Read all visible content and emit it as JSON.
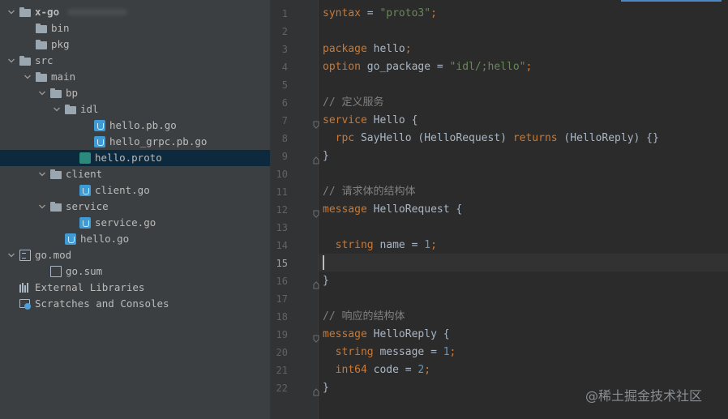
{
  "project_tree": {
    "rows": [
      {
        "label": "x-go",
        "icon": "folder-icon",
        "chevron": "down"
      },
      {
        "label": "bin",
        "icon": "folder-icon",
        "chevron": "none"
      },
      {
        "label": "pkg",
        "icon": "folder-icon",
        "chevron": "none"
      },
      {
        "label": "src",
        "icon": "folder-icon",
        "chevron": "down"
      },
      {
        "label": "main",
        "icon": "folder-icon",
        "chevron": "down"
      },
      {
        "label": "bp",
        "icon": "folder-icon",
        "chevron": "down"
      },
      {
        "label": "idl",
        "icon": "folder-icon",
        "chevron": "down"
      },
      {
        "label": "hello.pb.go",
        "icon": "go-file-icon",
        "chevron": "none"
      },
      {
        "label": "hello_grpc.pb.go",
        "icon": "go-file-icon",
        "chevron": "none"
      },
      {
        "label": "hello.proto",
        "icon": "proto-file-icon",
        "chevron": "none",
        "selected": true
      },
      {
        "label": "client",
        "icon": "folder-icon",
        "chevron": "down"
      },
      {
        "label": "client.go",
        "icon": "go-file-icon",
        "chevron": "none"
      },
      {
        "label": "service",
        "icon": "folder-icon",
        "chevron": "down"
      },
      {
        "label": "service.go",
        "icon": "go-file-icon",
        "chevron": "none"
      },
      {
        "label": "hello.go",
        "icon": "go-file-icon",
        "chevron": "none"
      },
      {
        "label": "go.mod",
        "icon": "go-mod-icon",
        "chevron": "down"
      },
      {
        "label": "go.sum",
        "icon": "go-sum-icon",
        "chevron": "none"
      },
      {
        "label": "External Libraries",
        "icon": "library-icon",
        "chevron": "none"
      },
      {
        "label": "Scratches and Consoles",
        "icon": "scratch-icon",
        "chevron": "none"
      }
    ]
  },
  "editor": {
    "current_line": "15",
    "line_numbers": [
      "1",
      "2",
      "3",
      "4",
      "5",
      "6",
      "7",
      "8",
      "9",
      "10",
      "11",
      "12",
      "13",
      "14",
      "15",
      "16",
      "17",
      "18",
      "19",
      "20",
      "21",
      "22"
    ],
    "lines": [
      [
        {
          "t": "syntax",
          "c": "kw"
        },
        {
          "t": " = ",
          "c": "ident"
        },
        {
          "t": "\"proto3\"",
          "c": "str"
        },
        {
          "t": ";",
          "c": "kw"
        }
      ],
      [],
      [
        {
          "t": "package",
          "c": "kw"
        },
        {
          "t": " hello",
          "c": "ident"
        },
        {
          "t": ";",
          "c": "kw"
        }
      ],
      [
        {
          "t": "option",
          "c": "kw"
        },
        {
          "t": " go_package = ",
          "c": "ident"
        },
        {
          "t": "\"idl/;hello\"",
          "c": "str"
        },
        {
          "t": ";",
          "c": "kw"
        }
      ],
      [],
      [
        {
          "t": "// 定义服务",
          "c": "cmt"
        }
      ],
      [
        {
          "t": "service",
          "c": "kw"
        },
        {
          "t": " Hello {",
          "c": "ident"
        }
      ],
      [
        {
          "t": "  ",
          "c": "ident"
        },
        {
          "t": "rpc",
          "c": "kw"
        },
        {
          "t": " SayHello (HelloRequest) ",
          "c": "ident"
        },
        {
          "t": "returns",
          "c": "kw"
        },
        {
          "t": " (HelloReply) {}",
          "c": "ident"
        }
      ],
      [
        {
          "t": "}",
          "c": "ident"
        }
      ],
      [],
      [
        {
          "t": "// 请求体的结构体",
          "c": "cmt"
        }
      ],
      [
        {
          "t": "message",
          "c": "kw"
        },
        {
          "t": " HelloRequest {",
          "c": "ident"
        }
      ],
      [],
      [
        {
          "t": "  ",
          "c": "ident"
        },
        {
          "t": "string",
          "c": "kw"
        },
        {
          "t": " name = ",
          "c": "ident"
        },
        {
          "t": "1",
          "c": "num"
        },
        {
          "t": ";",
          "c": "kw"
        }
      ],
      [],
      [
        {
          "t": "}",
          "c": "ident"
        }
      ],
      [],
      [
        {
          "t": "// 响应的结构体",
          "c": "cmt"
        }
      ],
      [
        {
          "t": "message",
          "c": "kw"
        },
        {
          "t": " HelloReply {",
          "c": "ident"
        }
      ],
      [
        {
          "t": "  ",
          "c": "ident"
        },
        {
          "t": "string",
          "c": "kw"
        },
        {
          "t": " message = ",
          "c": "ident"
        },
        {
          "t": "1",
          "c": "num"
        },
        {
          "t": ";",
          "c": "kw"
        }
      ],
      [
        {
          "t": "  ",
          "c": "ident"
        },
        {
          "t": "int64",
          "c": "kw"
        },
        {
          "t": " code = ",
          "c": "ident"
        },
        {
          "t": "2",
          "c": "num"
        },
        {
          "t": ";",
          "c": "kw"
        }
      ],
      [
        {
          "t": "}",
          "c": "ident"
        }
      ]
    ]
  },
  "colors": {
    "keyword": "#cc7832",
    "string": "#6a8759",
    "number": "#6897bb",
    "comment": "#808080",
    "text": "#a9b7c6",
    "selection": "#0d293e"
  },
  "watermark": "@稀土掘金技术社区"
}
